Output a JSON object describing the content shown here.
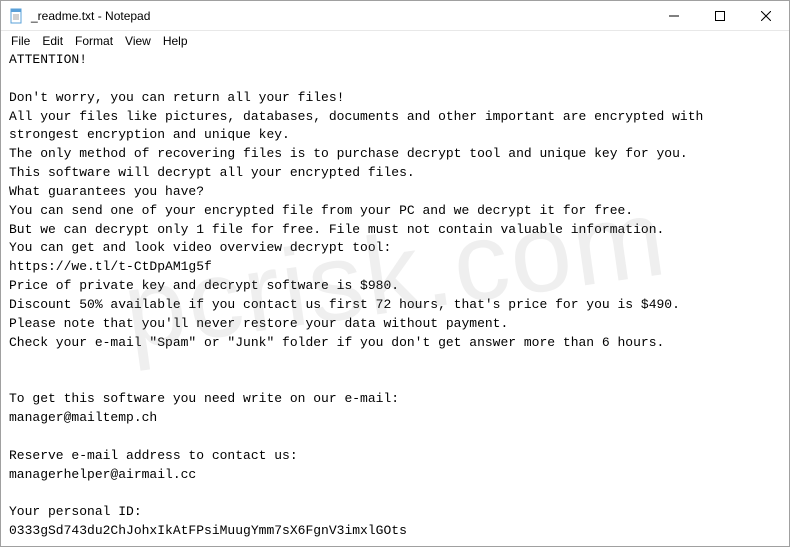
{
  "titlebar": {
    "icon_name": "notepad-icon",
    "title": "_readme.txt - Notepad"
  },
  "menu": {
    "file": "File",
    "edit": "Edit",
    "format": "Format",
    "view": "View",
    "help": "Help"
  },
  "content": "ATTENTION!\n\nDon't worry, you can return all your files!\nAll your files like pictures, databases, documents and other important are encrypted with strongest encryption and unique key.\nThe only method of recovering files is to purchase decrypt tool and unique key for you.\nThis software will decrypt all your encrypted files.\nWhat guarantees you have?\nYou can send one of your encrypted file from your PC and we decrypt it for free.\nBut we can decrypt only 1 file for free. File must not contain valuable information.\nYou can get and look video overview decrypt tool:\nhttps://we.tl/t-CtDpAM1g5f\nPrice of private key and decrypt software is $980.\nDiscount 50% available if you contact us first 72 hours, that's price for you is $490.\nPlease note that you'll never restore your data without payment.\nCheck your e-mail \"Spam\" or \"Junk\" folder if you don't get answer more than 6 hours.\n\n\nTo get this software you need write on our e-mail:\nmanager@mailtemp.ch\n\nReserve e-mail address to contact us:\nmanagerhelper@airmail.cc\n\nYour personal ID:\n0333gSd743du2ChJohxIkAtFPsiMuugYmm7sX6FgnV3imxlGOts",
  "watermark": "pcrisk.com"
}
